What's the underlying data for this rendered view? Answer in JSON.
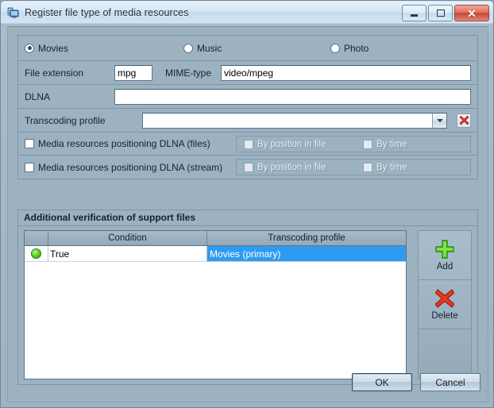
{
  "window": {
    "title": "Register file type of media resources",
    "icon": "server-monitor-icon",
    "controls": {
      "minimize": "Minimize",
      "maximize": "Maximize",
      "close": "Close"
    }
  },
  "media_type": {
    "options": [
      {
        "label": "Movies",
        "selected": true
      },
      {
        "label": "Music",
        "selected": false
      },
      {
        "label": "Photo",
        "selected": false
      }
    ]
  },
  "fields": {
    "file_extension": {
      "label": "File extension",
      "value": "mpg",
      "placeholder": ""
    },
    "mime_type": {
      "label": "MIME-type",
      "value": "video/mpeg",
      "placeholder": ""
    },
    "dlna": {
      "label": "DLNA",
      "value": "",
      "placeholder": ""
    },
    "transcoding_profile": {
      "label": "Transcoding profile",
      "value": "",
      "clear_icon": "red-x-icon"
    }
  },
  "positioning": {
    "files": {
      "label": "Media resources positioning DLNA (files)",
      "checked": false,
      "sub": [
        {
          "label": "By position in file",
          "checked": false,
          "disabled": true
        },
        {
          "label": "By time",
          "checked": false,
          "disabled": true
        }
      ]
    },
    "stream": {
      "label": "Media resources positioning DLNA  (stream)",
      "checked": false,
      "sub": [
        {
          "label": "By position in file",
          "checked": false,
          "disabled": true
        },
        {
          "label": "By time",
          "checked": false,
          "disabled": true
        }
      ]
    }
  },
  "verification": {
    "title": "Additional verification of support files",
    "columns": [
      "",
      "Condition",
      "Transcoding profile"
    ],
    "rows": [
      {
        "status": "green-dot-icon",
        "condition": "True",
        "profile": "Movies (primary)",
        "selected": true
      }
    ],
    "buttons": [
      {
        "label": "Add",
        "icon": "green-plus-icon"
      },
      {
        "label": "Delete",
        "icon": "red-x-icon"
      }
    ]
  },
  "footer": {
    "ok": "OK",
    "cancel": "Cancel"
  },
  "colors": {
    "background": "#9cb2c1",
    "selection": "#2f9bf0",
    "status_green": "#5fd32a",
    "close_red": "#c9452f"
  }
}
